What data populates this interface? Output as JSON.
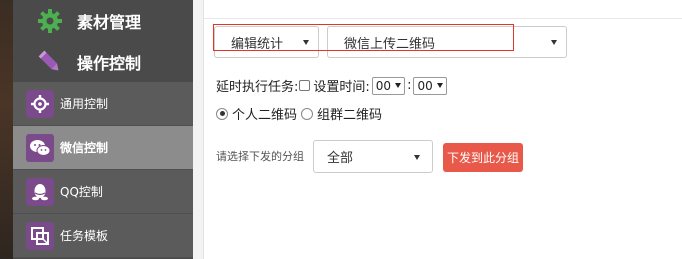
{
  "sidebar": {
    "top_items": [
      {
        "label": "素材管理",
        "icon": "gear-icon"
      },
      {
        "label": "操作控制",
        "icon": "pencil-icon"
      }
    ],
    "sub_items": [
      {
        "label": "通用控制",
        "icon": "settings-gear-icon",
        "active": false
      },
      {
        "label": "微信控制",
        "icon": "wechat-icon",
        "active": true
      },
      {
        "label": "QQ控制",
        "icon": "qq-penguin-icon",
        "active": false
      },
      {
        "label": "任务模板",
        "icon": "template-icon",
        "active": false
      }
    ],
    "colors": {
      "icon_green": "#4caf50",
      "pencil_purple": "#9b59b6",
      "sub_icon_bg": "#7b4a8a",
      "active_bg": "#8c8c8c"
    }
  },
  "main": {
    "category_select": "编辑统计",
    "action_select": "微信上传二维码",
    "delay": {
      "label": "延时执行任务:",
      "checkbox_label": "设置时间:",
      "hour": "00",
      "separator": ":",
      "minute": "00"
    },
    "qr_type": {
      "options": [
        "个人二维码",
        "组群二维码"
      ],
      "selected": "个人二维码"
    },
    "group": {
      "label": "请选择下发的分组",
      "selected": "全部"
    },
    "send_button": "下发到此分组",
    "colors": {
      "highlight_border": "#e0342c",
      "send_button_bg": "#e8594a"
    }
  }
}
